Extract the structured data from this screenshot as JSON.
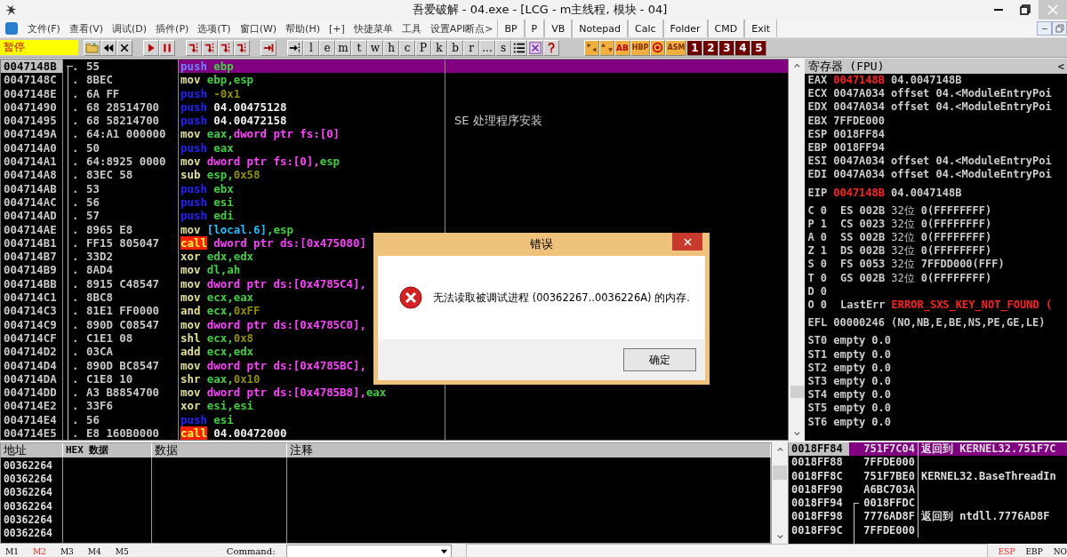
{
  "window": {
    "title": "吾爱破解 - 04.exe - [LCG - m主线程, 模块 - 04]"
  },
  "menu": [
    "文件(F)",
    "查看(V)",
    "调试(D)",
    "插件(P)",
    "选项(T)",
    "窗口(W)",
    "帮助(H)",
    "[+]",
    "快捷菜单",
    "工具",
    "设置API断点>"
  ],
  "quick_buttons": [
    "BP",
    "P",
    "VB",
    "Notepad",
    "Calc",
    "Folder",
    "CMD",
    "Exit"
  ],
  "status_label": "暂停",
  "toolbar_letters": [
    "l",
    "e",
    "m",
    "t",
    "w",
    "h",
    "c",
    "P",
    "k",
    "b",
    "r",
    "...",
    "s"
  ],
  "plugin_buttons": [
    "AB",
    "HBP",
    "ASM"
  ],
  "number_buttons": [
    "1",
    "2",
    "3",
    "4",
    "5"
  ],
  "disasm": {
    "rows": [
      {
        "address": "0047148B",
        "mark": ".",
        "jump_start": true,
        "hex": "55",
        "selected": true,
        "op": {
          "text": "push",
          "kind": "push"
        },
        "operands": [
          {
            "text": "ebp",
            "kind": "reg"
          }
        ]
      },
      {
        "address": "0047148C",
        "mark": ".",
        "jump_start": false,
        "hex": "8BEC",
        "selected": false,
        "op": {
          "text": "mov",
          "kind": "op"
        },
        "operands": [
          {
            "text": "ebp,",
            "kind": "reg"
          },
          {
            "text": "esp",
            "kind": "reg"
          }
        ]
      },
      {
        "address": "0047148E",
        "mark": ".",
        "jump_start": false,
        "hex": "6A FF",
        "selected": false,
        "op": {
          "text": "push",
          "kind": "push"
        },
        "operands": [
          {
            "text": "-0x1",
            "kind": "imm"
          }
        ]
      },
      {
        "address": "00471490",
        "mark": ".",
        "jump_start": false,
        "hex": "68 28514700",
        "selected": false,
        "op": {
          "text": "push",
          "kind": "push"
        },
        "operands": [
          {
            "text": "04.00475128",
            "kind": "addr"
          }
        ]
      },
      {
        "address": "00471495",
        "mark": ".",
        "jump_start": false,
        "hex": "68 58214700",
        "selected": false,
        "op": {
          "text": "push",
          "kind": "push"
        },
        "operands": [
          {
            "text": "04.00472158",
            "kind": "addr"
          }
        ],
        "comment": "SE 处理程序安装"
      },
      {
        "address": "0047149A",
        "mark": ".",
        "jump_start": false,
        "hex": "64:A1 000000",
        "selected": false,
        "op": {
          "text": "mov",
          "kind": "op"
        },
        "operands": [
          {
            "text": "eax,",
            "kind": "reg"
          },
          {
            "text": "dword ptr fs:[0]",
            "kind": "mem"
          }
        ]
      },
      {
        "address": "004714A0",
        "mark": ".",
        "jump_start": false,
        "hex": "50",
        "selected": false,
        "op": {
          "text": "push",
          "kind": "push"
        },
        "operands": [
          {
            "text": "eax",
            "kind": "reg"
          }
        ]
      },
      {
        "address": "004714A1",
        "mark": ".",
        "jump_start": false,
        "hex": "64:8925 0000",
        "selected": false,
        "op": {
          "text": "mov",
          "kind": "op"
        },
        "operands": [
          {
            "text": "dword ptr fs:[0],",
            "kind": "mem"
          },
          {
            "text": "esp",
            "kind": "reg"
          }
        ]
      },
      {
        "address": "004714A8",
        "mark": ".",
        "jump_start": false,
        "hex": "83EC 58",
        "selected": false,
        "op": {
          "text": "sub",
          "kind": "op"
        },
        "operands": [
          {
            "text": "esp,",
            "kind": "reg"
          },
          {
            "text": "0x58",
            "kind": "imm"
          }
        ]
      },
      {
        "address": "004714AB",
        "mark": ".",
        "jump_start": false,
        "hex": "53",
        "selected": false,
        "op": {
          "text": "push",
          "kind": "push"
        },
        "operands": [
          {
            "text": "ebx",
            "kind": "reg"
          }
        ]
      },
      {
        "address": "004714AC",
        "mark": ".",
        "jump_start": false,
        "hex": "56",
        "selected": false,
        "op": {
          "text": "push",
          "kind": "push"
        },
        "operands": [
          {
            "text": "esi",
            "kind": "reg"
          }
        ]
      },
      {
        "address": "004714AD",
        "mark": ".",
        "jump_start": false,
        "hex": "57",
        "selected": false,
        "op": {
          "text": "push",
          "kind": "push"
        },
        "operands": [
          {
            "text": "edi",
            "kind": "reg"
          }
        ]
      },
      {
        "address": "004714AE",
        "mark": ".",
        "jump_start": false,
        "hex": "8965 E8",
        "selected": false,
        "op": {
          "text": "mov",
          "kind": "op"
        },
        "operands": [
          {
            "text": "[local.6]",
            "kind": "local"
          },
          {
            "text": ",esp",
            "kind": "reg"
          }
        ]
      },
      {
        "address": "004714B1",
        "mark": ".",
        "jump_start": false,
        "hex": "FF15 805047",
        "selected": false,
        "op": {
          "text": "call",
          "kind": "call"
        },
        "operands": [
          {
            "text": "dword ptr ds:[0x475080]",
            "kind": "mem"
          }
        ]
      },
      {
        "address": "004714B7",
        "mark": ".",
        "jump_start": false,
        "hex": "33D2",
        "selected": false,
        "op": {
          "text": "xor",
          "kind": "op"
        },
        "operands": [
          {
            "text": "edx,",
            "kind": "reg"
          },
          {
            "text": "edx",
            "kind": "reg"
          }
        ]
      },
      {
        "address": "004714B9",
        "mark": ".",
        "jump_start": false,
        "hex": "8AD4",
        "selected": false,
        "op": {
          "text": "mov",
          "kind": "op"
        },
        "operands": [
          {
            "text": "dl,",
            "kind": "reg"
          },
          {
            "text": "ah",
            "kind": "reg"
          }
        ]
      },
      {
        "address": "004714BB",
        "mark": ".",
        "jump_start": false,
        "hex": "8915 C48547",
        "selected": false,
        "op": {
          "text": "mov",
          "kind": "op"
        },
        "operands": [
          {
            "text": "dword ptr ds:[0x4785C4],",
            "kind": "mem"
          }
        ]
      },
      {
        "address": "004714C1",
        "mark": ".",
        "jump_start": false,
        "hex": "8BC8",
        "selected": false,
        "op": {
          "text": "mov",
          "kind": "op"
        },
        "operands": [
          {
            "text": "ecx,",
            "kind": "reg"
          },
          {
            "text": "eax",
            "kind": "reg"
          }
        ]
      },
      {
        "address": "004714C3",
        "mark": ".",
        "jump_start": false,
        "hex": "81E1 FF0000",
        "selected": false,
        "op": {
          "text": "and",
          "kind": "op"
        },
        "operands": [
          {
            "text": "ecx,",
            "kind": "reg"
          },
          {
            "text": "0xFF",
            "kind": "imm"
          }
        ]
      },
      {
        "address": "004714C9",
        "mark": ".",
        "jump_start": false,
        "hex": "890D C08547",
        "selected": false,
        "op": {
          "text": "mov",
          "kind": "op"
        },
        "operands": [
          {
            "text": "dword ptr ds:[0x4785C0],",
            "kind": "mem"
          }
        ]
      },
      {
        "address": "004714CF",
        "mark": ".",
        "jump_start": false,
        "hex": "C1E1 08",
        "selected": false,
        "op": {
          "text": "shl",
          "kind": "op"
        },
        "operands": [
          {
            "text": "ecx,",
            "kind": "reg"
          },
          {
            "text": "0x8",
            "kind": "imm"
          }
        ]
      },
      {
        "address": "004714D2",
        "mark": ".",
        "jump_start": false,
        "hex": "03CA",
        "selected": false,
        "op": {
          "text": "add",
          "kind": "op"
        },
        "operands": [
          {
            "text": "ecx,",
            "kind": "reg"
          },
          {
            "text": "edx",
            "kind": "reg"
          }
        ]
      },
      {
        "address": "004714D4",
        "mark": ".",
        "jump_start": false,
        "hex": "890D BC8547",
        "selected": false,
        "op": {
          "text": "mov",
          "kind": "op"
        },
        "operands": [
          {
            "text": "dword ptr ds:[0x4785BC],",
            "kind": "mem"
          }
        ]
      },
      {
        "address": "004714DA",
        "mark": ".",
        "jump_start": false,
        "hex": "C1E8 10",
        "selected": false,
        "op": {
          "text": "shr",
          "kind": "op"
        },
        "operands": [
          {
            "text": "eax,",
            "kind": "reg"
          },
          {
            "text": "0x10",
            "kind": "imm"
          }
        ]
      },
      {
        "address": "004714DD",
        "mark": ".",
        "jump_start": false,
        "hex": "A3 B8854700",
        "selected": false,
        "op": {
          "text": "mov",
          "kind": "op"
        },
        "operands": [
          {
            "text": "dword ptr ds:[0x4785B8],",
            "kind": "mem"
          },
          {
            "text": "eax",
            "kind": "reg"
          }
        ]
      },
      {
        "address": "004714E2",
        "mark": ".",
        "jump_start": false,
        "hex": "33F6",
        "selected": false,
        "op": {
          "text": "xor",
          "kind": "op"
        },
        "operands": [
          {
            "text": "esi,",
            "kind": "reg"
          },
          {
            "text": "esi",
            "kind": "reg"
          }
        ]
      },
      {
        "address": "004714E4",
        "mark": ".",
        "jump_start": false,
        "hex": "56",
        "selected": false,
        "op": {
          "text": "push",
          "kind": "push"
        },
        "operands": [
          {
            "text": "esi",
            "kind": "reg"
          }
        ]
      },
      {
        "address": "004714E5",
        "mark": ".",
        "jump_start": false,
        "hex": "E8 160B0000",
        "selected": false,
        "op": {
          "text": "call",
          "kind": "call"
        },
        "operands": [
          {
            "text": "04.00472000",
            "kind": "addr"
          }
        ]
      }
    ]
  },
  "registers": {
    "title": "寄存器 (FPU)",
    "collapse": "<",
    "general": [
      {
        "name": "EAX",
        "value": "0047148B",
        "changed": true,
        "comment": "04.0047148B"
      },
      {
        "name": "ECX",
        "value": "0047A034",
        "changed": false,
        "comment": "offset 04.<ModuleEntryPoi"
      },
      {
        "name": "EDX",
        "value": "0047A034",
        "changed": false,
        "comment": "offset 04.<ModuleEntryPoi"
      },
      {
        "name": "EBX",
        "value": "7FFDE000",
        "changed": false
      },
      {
        "name": "ESP",
        "value": "0018FF84",
        "changed": false
      },
      {
        "name": "EBP",
        "value": "0018FF94",
        "changed": false
      },
      {
        "name": "ESI",
        "value": "0047A034",
        "changed": false,
        "comment": "offset 04.<ModuleEntryPoi"
      },
      {
        "name": "EDI",
        "value": "0047A034",
        "changed": false,
        "comment": "offset 04.<ModuleEntryPoi"
      }
    ],
    "eip": {
      "name": "EIP",
      "value": "0047148B",
      "changed": true,
      "comment": "04.0047148B"
    },
    "flags": [
      {
        "flag": "C",
        "value": "0",
        "segment": "ES",
        "selector": "002B",
        "bits": "32位",
        "base": "0(FFFFFFFF)"
      },
      {
        "flag": "P",
        "value": "1",
        "segment": "CS",
        "selector": "0023",
        "bits": "32位",
        "base": "0(FFFFFFFF)"
      },
      {
        "flag": "A",
        "value": "0",
        "segment": "SS",
        "selector": "002B",
        "bits": "32位",
        "base": "0(FFFFFFFF)"
      },
      {
        "flag": "Z",
        "value": "1",
        "segment": "DS",
        "selector": "002B",
        "bits": "32位",
        "base": "0(FFFFFFFF)"
      },
      {
        "flag": "S",
        "value": "0",
        "segment": "FS",
        "selector": "0053",
        "bits": "32位",
        "base": "7FFDD000(FFF)"
      },
      {
        "flag": "T",
        "value": "0",
        "segment": "GS",
        "selector": "002B",
        "bits": "32位",
        "base": "0(FFFFFFFF)"
      },
      {
        "flag": "D",
        "value": "0"
      }
    ],
    "last_error": {
      "flag": "O",
      "value": "0",
      "label": "LastErr",
      "error": "ERROR_SXS_KEY_NOT_FOUND ("
    },
    "efl": {
      "name": "EFL",
      "value": "00000246",
      "conditions": "(NO,NB,E,BE,NS,PE,GE,LE)"
    },
    "fpu": [
      {
        "name": "ST0",
        "tag": "empty",
        "value": "0.0"
      },
      {
        "name": "ST1",
        "tag": "empty",
        "value": "0.0"
      },
      {
        "name": "ST2",
        "tag": "empty",
        "value": "0.0"
      },
      {
        "name": "ST3",
        "tag": "empty",
        "value": "0.0"
      },
      {
        "name": "ST4",
        "tag": "empty",
        "value": "0.0"
      },
      {
        "name": "ST5",
        "tag": "empty",
        "value": "0.0"
      },
      {
        "name": "ST6",
        "tag": "empty",
        "value": "0.0"
      }
    ]
  },
  "dump": {
    "columns": [
      "地址",
      "HEX 数据",
      "数据",
      "注释"
    ],
    "rows": [
      "00362264",
      "00362264",
      "00362264",
      "00362264",
      "00362264",
      "00362264"
    ]
  },
  "stack": {
    "rows": [
      {
        "address": "0018FF84",
        "value": "751F7C04",
        "selected": true,
        "frame_start": false,
        "comment": "返回到 KERNEL32.751F7C"
      },
      {
        "address": "0018FF88",
        "value": "7FFDE000",
        "selected": false,
        "frame_start": false
      },
      {
        "address": "0018FF8C",
        "value": "751F7BE0",
        "selected": false,
        "frame_start": false,
        "comment": "KERNEL32.BaseThreadIn"
      },
      {
        "address": "0018FF90",
        "value": "A6BC703A",
        "selected": false,
        "frame_start": false
      },
      {
        "address": "0018FF94",
        "value": "0018FFDC",
        "selected": false,
        "frame_start": true
      },
      {
        "address": "0018FF98",
        "value": "7776AD8F",
        "selected": false,
        "frame_start": false,
        "comment": "返回到 ntdll.7776AD8F"
      },
      {
        "address": "0018FF9C",
        "value": "7FFDE000",
        "selected": false,
        "frame_start": false
      }
    ]
  },
  "status_bar": {
    "memory_tabs": [
      {
        "label": "M1",
        "selected": false
      },
      {
        "label": "M2",
        "selected": true
      },
      {
        "label": "M3",
        "selected": false
      },
      {
        "label": "M4",
        "selected": false
      },
      {
        "label": "M5",
        "selected": false
      }
    ],
    "command_label": "Command:",
    "base_buttons": [
      {
        "label": "ESP",
        "selected": true
      },
      {
        "label": "EBP",
        "selected": false
      },
      {
        "label": "NO",
        "selected": false
      }
    ]
  },
  "dialog": {
    "title": "错误",
    "message": "无法读取被调试进程 (00362267..0036226A) 的内存.",
    "button": "确定"
  }
}
